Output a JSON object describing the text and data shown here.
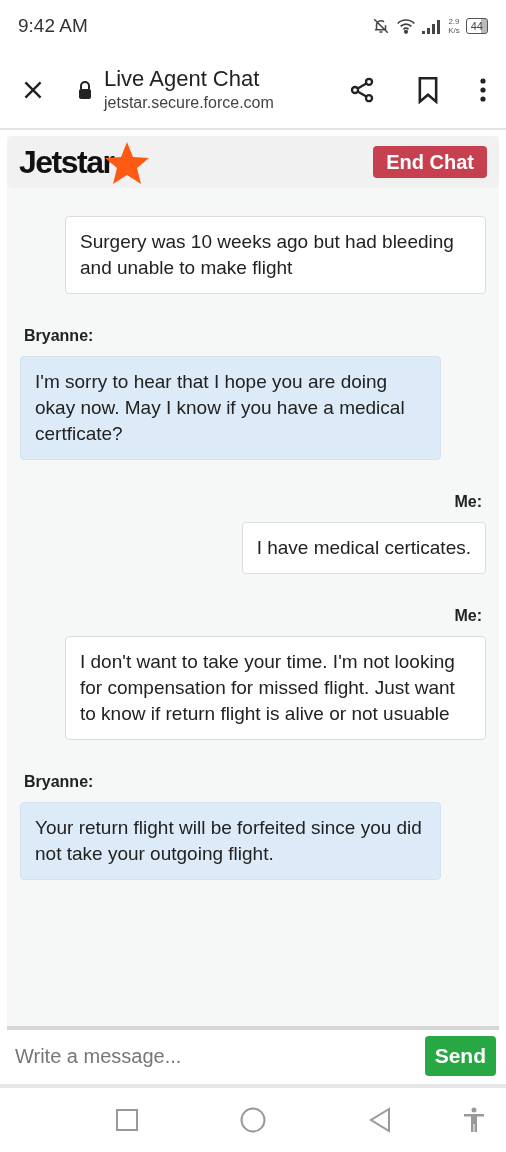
{
  "status_bar": {
    "time": "9:42 AM",
    "speed_value": "2.9",
    "speed_unit": "K/s",
    "battery": "44"
  },
  "browser_bar": {
    "title": "Live Agent Chat",
    "url": "jetstar.secure.force.com"
  },
  "chat_header": {
    "logo": "Jetstar",
    "end_button": "End Chat"
  },
  "messages": [
    {
      "kind": "me",
      "text": "Surgery was 10 weeks ago but had bleeding and unable to make flight"
    },
    {
      "kind": "agent",
      "sender": "Bryanne:",
      "text": "I'm sorry to hear that I hope you are doing okay now. May I know if you have a medical certficate?"
    },
    {
      "kind": "me",
      "sender": "Me:",
      "text": "I have medical certicates."
    },
    {
      "kind": "me",
      "sender": "Me:",
      "text": "I don't want to take your time. I'm not looking for compensation for missed flight. Just want to know if return flight is alive or not usuable"
    },
    {
      "kind": "agent",
      "sender": "Bryanne:",
      "text": "Your return flight will be forfeited since you did not take your outgoing flight."
    }
  ],
  "composer": {
    "placeholder": "Write a message...",
    "send_button": "Send"
  }
}
